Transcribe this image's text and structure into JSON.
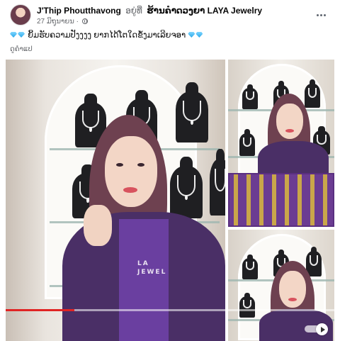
{
  "post": {
    "author": "J'Thip Phoutthavong",
    "verb": "ອຍູ່ທີ່",
    "place": "ຮ້ານຄຳດວງຍາ LAYA Jewelry",
    "date": "27 ມິຖຸນາຍນ ·",
    "caption_text": "ຍິ້ມຮັບຄວາມປັງງງງ ຍາກໄດ້ໂຕໃດຂໍ້ງມາເລີຍຈອາ",
    "translate_label": "ດູຄຳແປ",
    "accent_color": "#e02424"
  },
  "media": {
    "shirt_logo": "LA\nJEWEL",
    "video_progress_percent": 21
  },
  "icons": {
    "menu": "more-horizontal-icon",
    "privacy": "globe-icon",
    "play": "play-icon",
    "emoji": "gem-emoji-icon"
  }
}
